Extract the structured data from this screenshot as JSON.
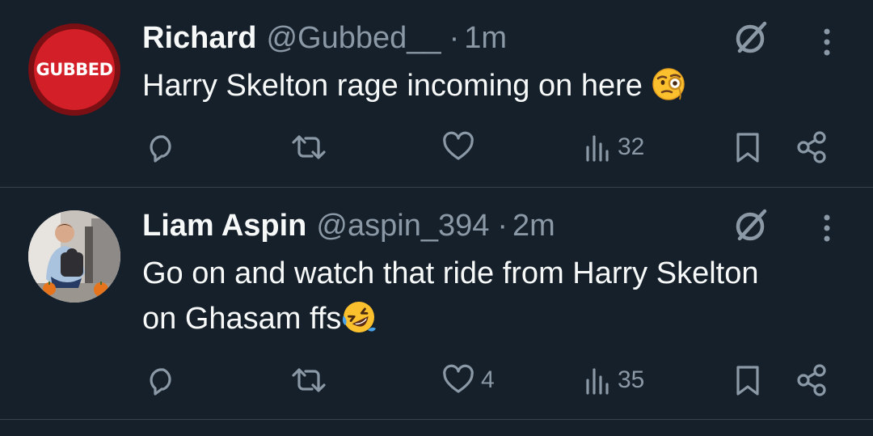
{
  "tweets": [
    {
      "author_name": "Richard",
      "handle": "@Gubbed__",
      "separator": "·",
      "time": "1m",
      "avatar_text": "GUBBED",
      "text": "Harry Skelton rage incoming on here",
      "emoji": "face-with-monocle",
      "reply_count": "",
      "retweet_count": "",
      "like_count": "",
      "views_count": "32"
    },
    {
      "author_name": "Liam Aspin",
      "handle": "@aspin_394",
      "separator": "·",
      "time": "2m",
      "text_line1": "Go on and watch that ride from Harry Skelton",
      "text_line2": "on Ghasam ffs",
      "emoji": "rolling-on-the-floor-laughing",
      "reply_count": "",
      "retweet_count": "",
      "like_count": "4",
      "views_count": "35"
    }
  ],
  "colors": {
    "background": "#15202b",
    "divider": "#38444d",
    "text_primary": "#f7f9f9",
    "text_secondary": "#8b98a5",
    "avatar_red": "#d31f27"
  }
}
